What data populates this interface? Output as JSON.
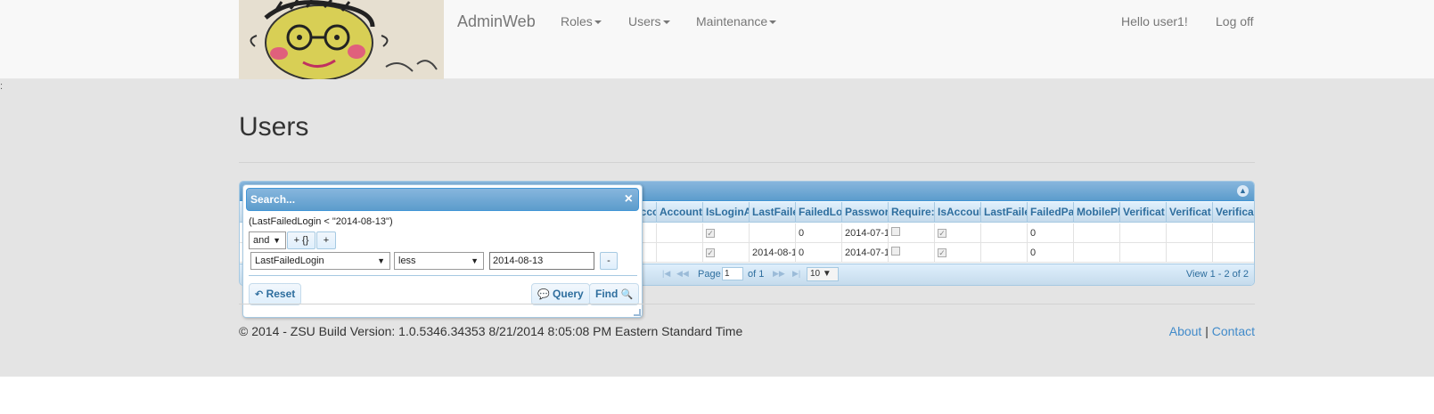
{
  "navbar": {
    "brand": "AdminWeb",
    "menu": [
      {
        "label": "Roles"
      },
      {
        "label": "Users"
      },
      {
        "label": "Maintenance"
      }
    ],
    "greeting": "Hello user1!",
    "logoff": "Log off"
  },
  "stray_char": ":",
  "page": {
    "title": "Users"
  },
  "grid": {
    "columns": [
      "Accou",
      "Account",
      "IsLoginA",
      "LastFaile",
      "FailedLo",
      "Passwor",
      "Require:",
      "IsAccoul",
      "LastFaile",
      "FailedPa",
      "MobilePl",
      "Verificat",
      "Verificat",
      "Verifica"
    ],
    "rows": [
      [
        "",
        "",
        "checked",
        "",
        "0",
        "2014-07-1",
        "unchecked",
        "checked",
        "",
        "0",
        "",
        "",
        "",
        ""
      ],
      [
        "",
        "",
        "checked",
        "2014-08-1",
        "0",
        "2014-07-1",
        "unchecked",
        "checked",
        "",
        "0",
        "",
        "",
        "",
        ""
      ]
    ],
    "pager": {
      "page_label": "Page",
      "page_value": "1",
      "of_label": "of 1",
      "rows_per_page": "10",
      "view_info": "View 1 - 2 of 2"
    }
  },
  "search_dialog": {
    "title": "Search...",
    "close": "×",
    "filter_expression": "(LastFailedLogin < \"2014-08-13\")",
    "group_op": "and",
    "add_group": "+ {}",
    "add_rule": "+",
    "rule": {
      "field": "LastFailedLogin",
      "operator": "less",
      "value": "2014-08-13",
      "remove": "-"
    },
    "reset": "Reset",
    "query": "Query",
    "find": "Find"
  },
  "footer": {
    "copyright": "© 2014 - ZSU Build Version: 1.0.5346.34353 8/21/2014 8:05:08 PM Eastern Standard Time",
    "about": "About",
    "separator": "|",
    "contact": "Contact"
  },
  "colors": {
    "accent": "#428bca",
    "grid_header": "#5c9ccc",
    "grid_text": "#2e6e9e"
  }
}
